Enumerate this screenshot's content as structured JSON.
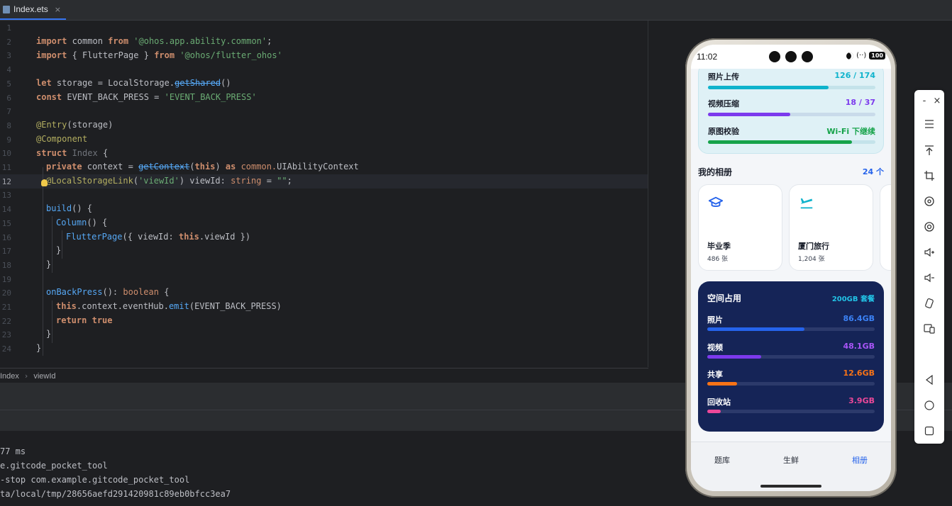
{
  "tab": {
    "label": "Index.ets",
    "close": "×"
  },
  "gutter": [
    "1",
    "2",
    "3",
    "4",
    "5",
    "6",
    "7",
    "8",
    "9",
    "10",
    "11",
    "12",
    "13",
    "14",
    "15",
    "16",
    "17",
    "18",
    "19",
    "20",
    "21",
    "22",
    "23",
    "24"
  ],
  "code": {
    "l2": {
      "a": "import",
      "b": " common ",
      "c": "from",
      "d": " '@ohos.app.ability.common'",
      "e": ";"
    },
    "l3": {
      "a": "import",
      "b": " { FlutterPage } ",
      "c": "from",
      "d": " '@ohos/flutter_ohos'"
    },
    "l5": {
      "a": "let",
      "b": " storage = LocalStorage.",
      "c": "getShared",
      "d": "()"
    },
    "l6": {
      "a": "const",
      "b": " EVENT_BACK_PRESS = ",
      "c": "'EVENT_BACK_PRESS'"
    },
    "l8": {
      "a": "@Entry",
      "b": "(storage)"
    },
    "l9": {
      "a": "@Component"
    },
    "l10": {
      "a": "struct",
      "b": " Index ",
      "c": "{"
    },
    "l11": {
      "a": "private",
      "b": " context = ",
      "c": "getContext",
      "d": "(",
      "e": "this",
      "f": ") ",
      "g": "as",
      "h": " common.",
      "i": "UIAbilityContext"
    },
    "l12": {
      "a": "@LocalStorageLink",
      "b": "(",
      "c": "'viewId'",
      "d": ") viewId: ",
      "e": "string",
      "f": " = ",
      "g": "\"\"",
      "h": ";"
    },
    "l14": {
      "a": "build",
      "b": "() {"
    },
    "l15": {
      "a": "Column",
      "b": "() {"
    },
    "l16": {
      "a": "FlutterPage",
      "b": "({ viewId: ",
      "c": "this",
      "d": ".viewId })"
    },
    "l17": {
      "a": "}"
    },
    "l18": {
      "a": "}"
    },
    "l20": {
      "a": "onBackPress",
      "b": "(): ",
      "c": "boolean",
      "d": " {"
    },
    "l21": {
      "a": "this",
      "b": ".context.eventHub.",
      "c": "emit",
      "d": "(EVENT_BACK_PRESS)"
    },
    "l22": {
      "a": "return",
      "b": " ",
      "c": "true"
    },
    "l23": {
      "a": "}"
    },
    "l24": {
      "a": "}"
    }
  },
  "breadcrumb": {
    "a": "Index",
    "b": "viewId"
  },
  "console": [
    "77 ms",
    "e.gitcode_pocket_tool",
    "-stop com.example.gitcode_pocket_tool",
    "ta/local/tmp/28656aefd291420981c89eb0bfcc3ea7"
  ],
  "phone": {
    "time": "11:02",
    "status_text": "(··)",
    "battery": "100",
    "upload": [
      {
        "label": "照片上传",
        "value": "126 / 174",
        "progress": 0.72,
        "color": "#0fb3cc",
        "value_color": "#0fb3cc"
      },
      {
        "label": "视频压缩",
        "value": "18 / 37",
        "progress": 0.49,
        "color": "#7c3aed",
        "value_color": "#7c3aed"
      },
      {
        "label": "原图校验",
        "value": "Wi-Fi 下继续",
        "progress": 0.86,
        "color": "#16a34a",
        "value_color": "#16a34a"
      }
    ],
    "albums_title": "我的相册",
    "albums_count": "24 个",
    "albums": [
      {
        "name": "毕业季",
        "count": "486 张",
        "icon": "graduation-cap-icon"
      },
      {
        "name": "厦门旅行",
        "count": "1,204 张",
        "icon": "airplane-icon"
      }
    ],
    "storage": {
      "title": "空间占用",
      "plan": "200GB 套餐",
      "rows": [
        {
          "label": "照片",
          "value": "86.4GB",
          "progress": 0.58,
          "color": "#2563eb",
          "value_color": "#3b82f6"
        },
        {
          "label": "视频",
          "value": "48.1GB",
          "progress": 0.32,
          "color": "#7c3aed",
          "value_color": "#a855f7"
        },
        {
          "label": "共享",
          "value": "12.6GB",
          "progress": 0.18,
          "color": "#f97316",
          "value_color": "#f97316"
        },
        {
          "label": "回收站",
          "value": "3.9GB",
          "progress": 0.08,
          "color": "#ec4899",
          "value_color": "#ec4899"
        }
      ]
    },
    "nav": {
      "a": "题库",
      "b": "生鲜",
      "c": "相册"
    }
  },
  "toolbar": {
    "minimize": "-",
    "close": "×"
  }
}
